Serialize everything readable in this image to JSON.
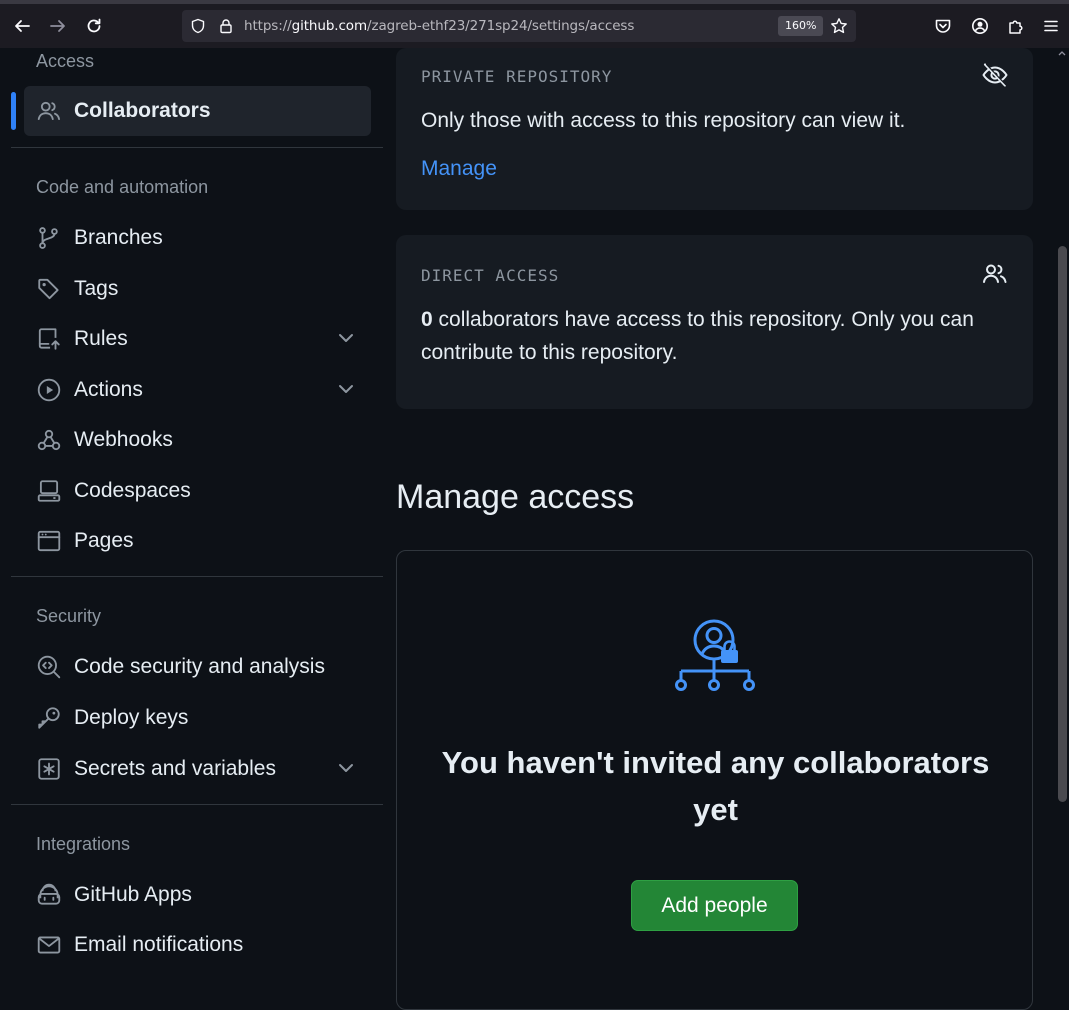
{
  "browser": {
    "url_prefix": "https://",
    "url_host": "github.com",
    "url_path": "/zagreb-ethf23/271sp24/settings/access",
    "zoom": "160%"
  },
  "sidebar": {
    "sections": {
      "access": "Access",
      "code_automation": "Code and automation",
      "security": "Security",
      "integrations": "Integrations"
    },
    "items": {
      "collaborators": "Collaborators",
      "branches": "Branches",
      "tags": "Tags",
      "rules": "Rules",
      "actions": "Actions",
      "webhooks": "Webhooks",
      "codespaces": "Codespaces",
      "pages": "Pages",
      "code_security": "Code security and analysis",
      "deploy_keys": "Deploy keys",
      "secrets": "Secrets and variables",
      "github_apps": "GitHub Apps",
      "email": "Email notifications"
    }
  },
  "main": {
    "private_card": {
      "label": "PRIVATE REPOSITORY",
      "text": "Only those with access to this repository can view it.",
      "link": "Manage"
    },
    "direct_card": {
      "label": "DIRECT ACCESS",
      "count": "0",
      "text": " collaborators have access to this repository. Only you can contribute to this repository."
    },
    "manage_heading": "Manage access",
    "empty": {
      "title": "You haven't invited any collaborators yet",
      "button": "Add people"
    }
  },
  "colors": {
    "accent_blue": "#2f81f7",
    "link_blue": "#4493f8",
    "button_green": "#238636",
    "background": "#0d1117",
    "card": "#161b22"
  }
}
